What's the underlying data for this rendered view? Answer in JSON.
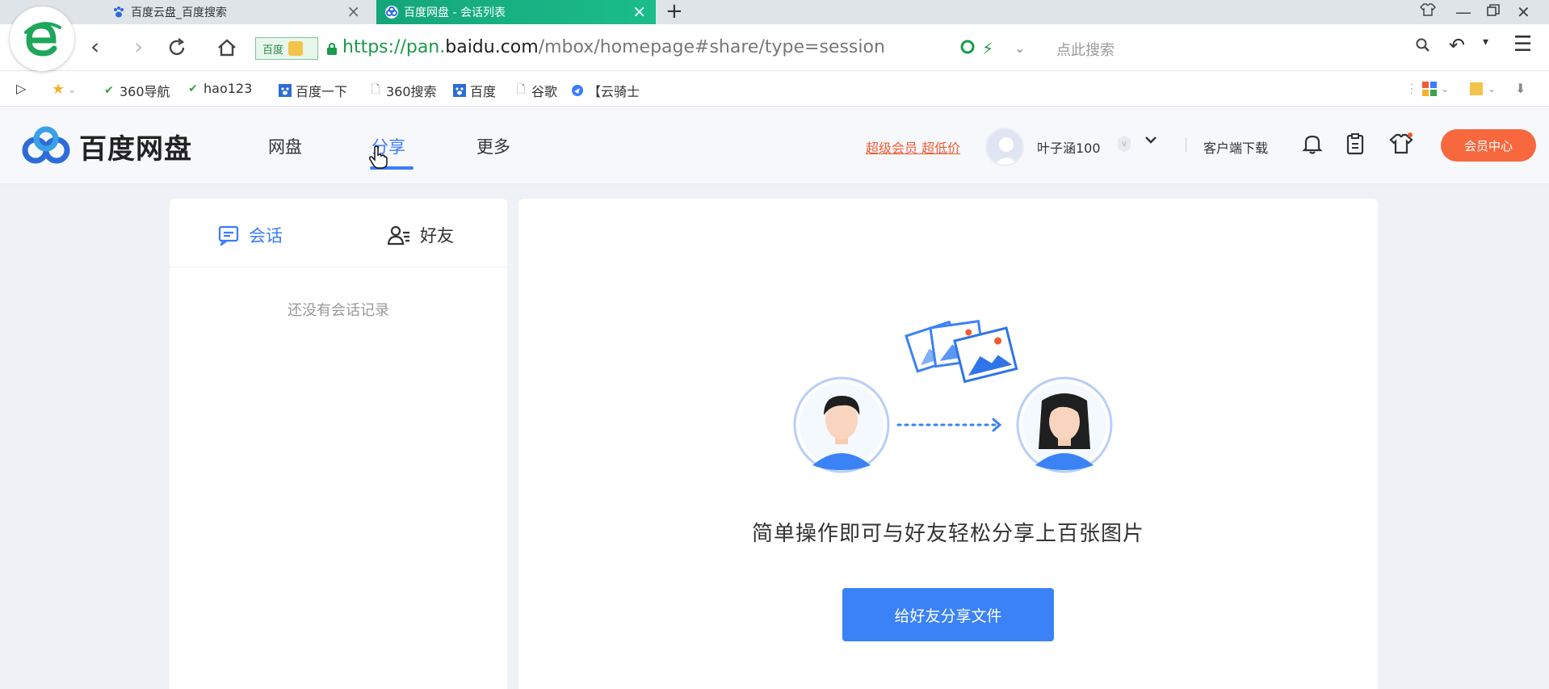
{
  "browser": {
    "tabs": [
      {
        "title": "百度云盘_百度搜索",
        "active": false
      },
      {
        "title": "百度网盘 - 会话列表",
        "active": true
      }
    ],
    "new_tab": "+",
    "address": {
      "search_engine": "百度",
      "url_scheme": "https://pan.",
      "url_domain": "baidu.com",
      "url_path": "/mbox/homepage#share/type=session",
      "search_placeholder": "点此搜索"
    },
    "bookmarks": [
      {
        "label": "360导航",
        "icon": "360-icon"
      },
      {
        "label": "hao123",
        "icon": "hao123-icon"
      },
      {
        "label": "百度一下",
        "icon": "baidu-paw-icon"
      },
      {
        "label": "360搜索",
        "icon": "page-icon"
      },
      {
        "label": "百度",
        "icon": "baidu-paw-icon"
      },
      {
        "label": "谷歌",
        "icon": "page-icon"
      },
      {
        "label": "【云骑士",
        "icon": "cloud-icon"
      }
    ]
  },
  "pan": {
    "logo_text": "百度网盘",
    "nav": [
      {
        "label": "网盘",
        "active": false
      },
      {
        "label": "分享",
        "active": true
      },
      {
        "label": "更多",
        "active": false
      }
    ],
    "vip_link": "超级会员 超低价",
    "username": "叶子涵100",
    "client_download": "客户端下载",
    "member_center": "会员中心"
  },
  "left_panel": {
    "tabs": [
      {
        "label": "会话",
        "active": true,
        "icon": "chat-icon"
      },
      {
        "label": "好友",
        "active": false,
        "icon": "friends-icon"
      }
    ],
    "empty_text": "还没有会话记录"
  },
  "right_panel": {
    "message": "简单操作即可与好友轻松分享上百张图片",
    "button": "给好友分享文件"
  },
  "colors": {
    "accent": "#3b82f6",
    "active_tab_green": "#14a57a",
    "vip_orange": "#f25a33",
    "member_btn": "#f7683f"
  }
}
